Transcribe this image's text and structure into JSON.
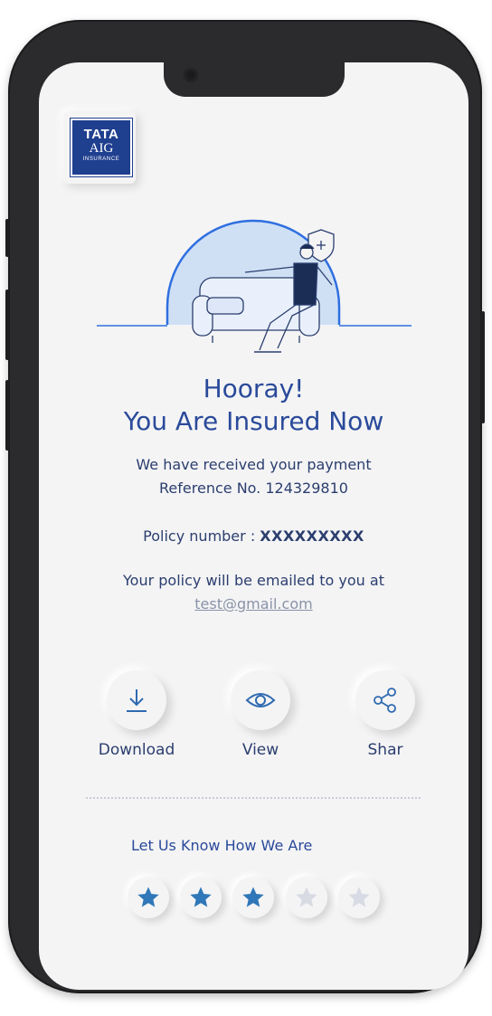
{
  "brand": {
    "line1": "TATA",
    "line2": "AIG",
    "line3": "INSURANCE",
    "color": "#1f3f8f"
  },
  "heading": {
    "line1": "Hooray!",
    "line2": "You Are Insured Now"
  },
  "payment": {
    "received_text": "We have received your payment",
    "reference_text": "Reference No. 124329810"
  },
  "policy": {
    "label": "Policy number : ",
    "value": "XXXXXXXXX"
  },
  "email": {
    "intro": "Your policy will be emailed to you at",
    "address": "test@gmail.com"
  },
  "actions": [
    {
      "label": "Download",
      "icon": "download-icon"
    },
    {
      "label": "View",
      "icon": "eye-icon"
    },
    {
      "label": "Shar",
      "icon": "share-icon"
    }
  ],
  "rating": {
    "label": "Let Us Know How We Are",
    "value": 3,
    "max": 5,
    "filled_color": "#2f77b8",
    "empty_color": "#d8dbe3"
  },
  "colors": {
    "primary": "#2a4a9a",
    "text": "#2b3e6e",
    "background": "#f4f4f5"
  }
}
